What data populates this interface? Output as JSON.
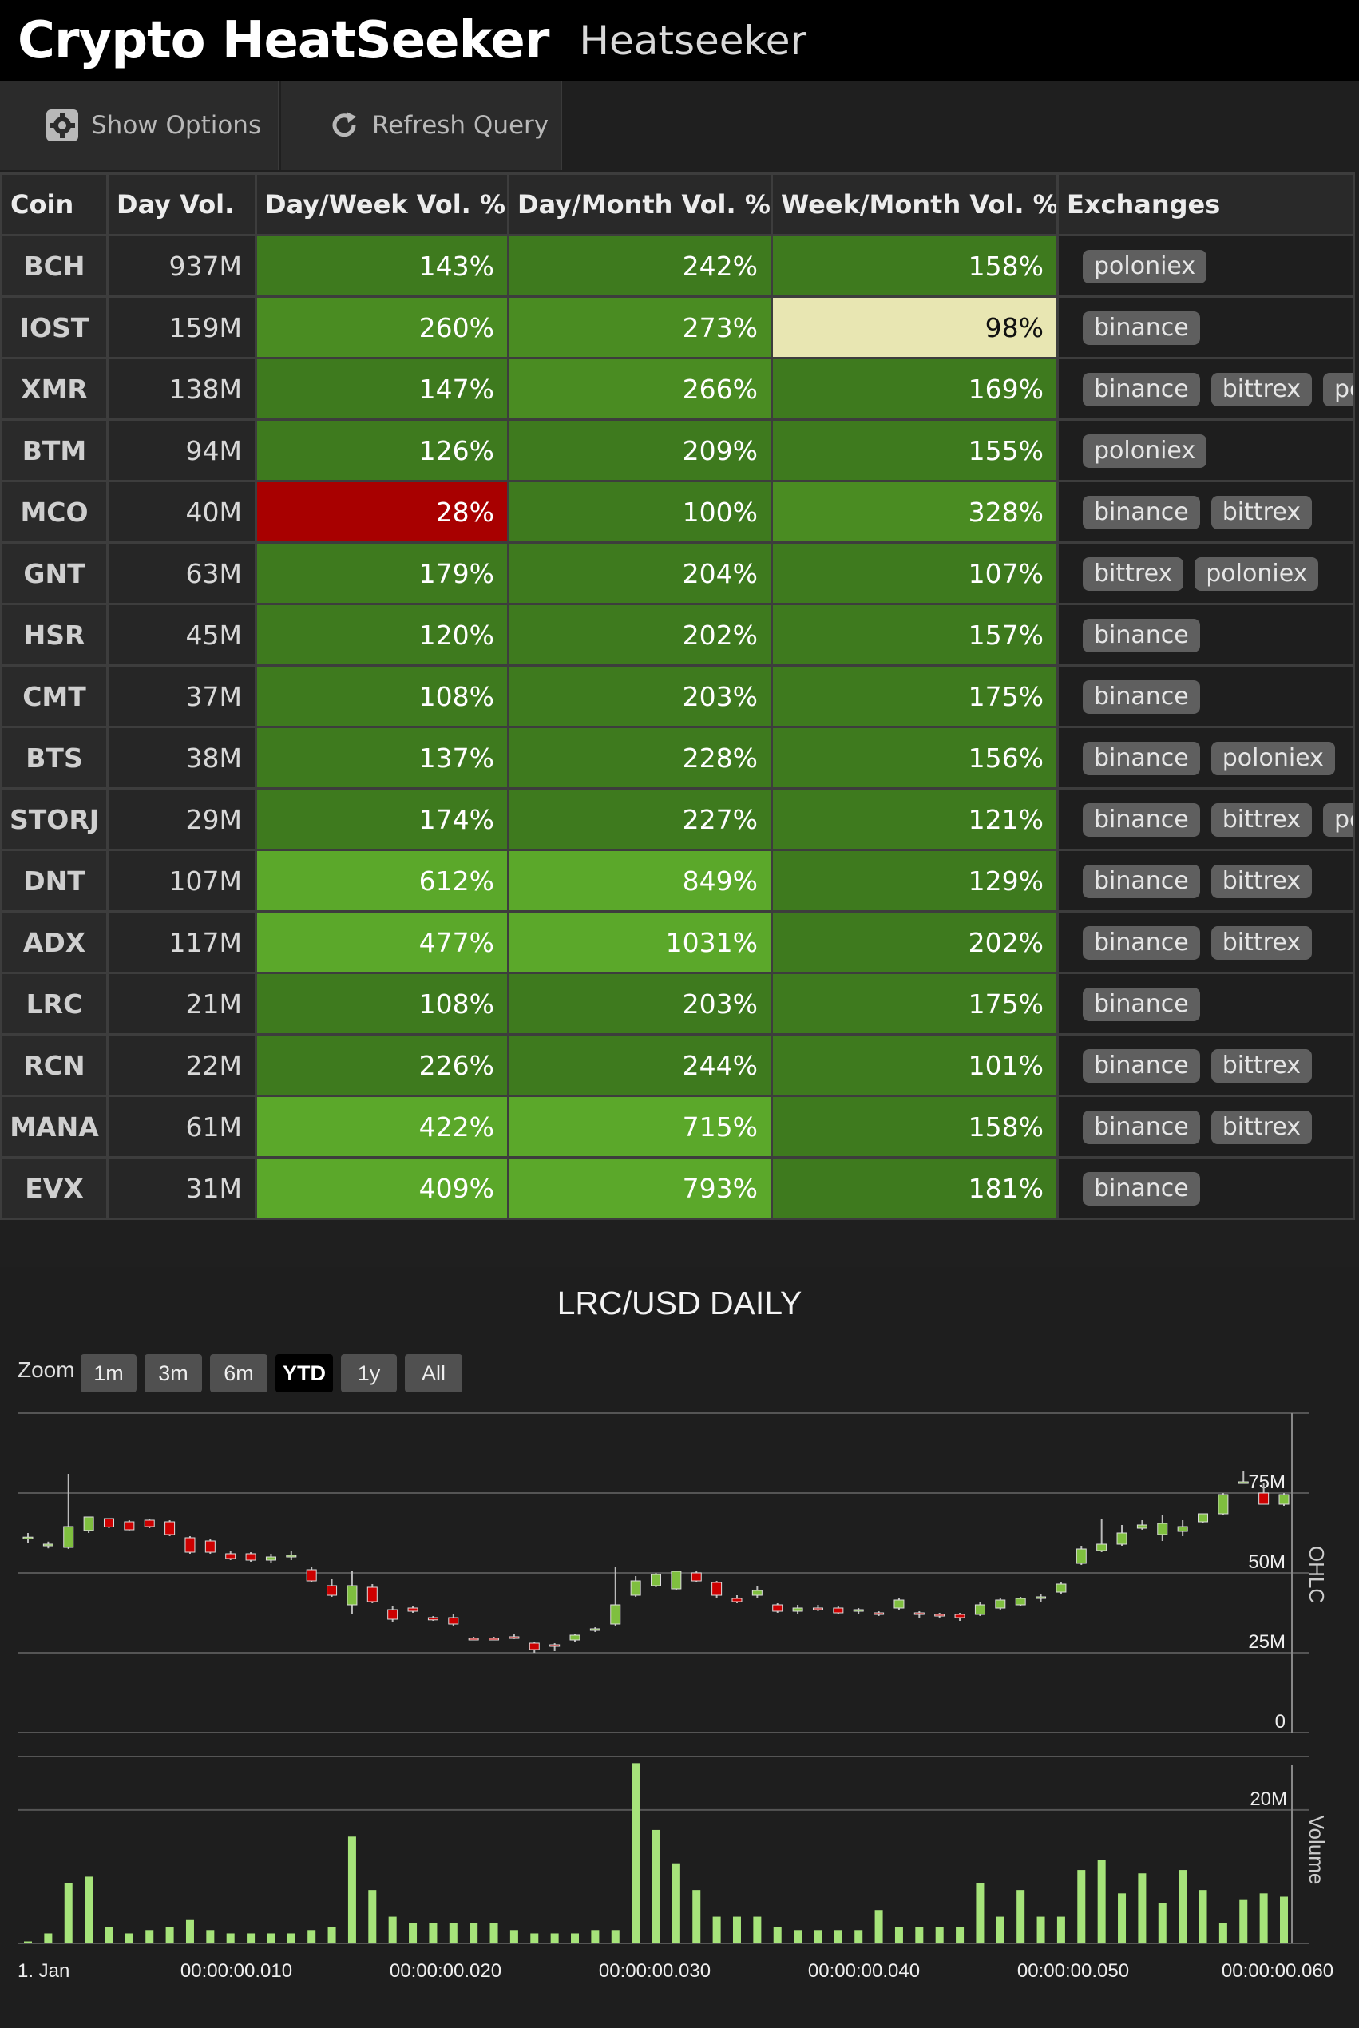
{
  "app": {
    "title": "Crypto HeatSeeker",
    "subtitle": "Heatseeker"
  },
  "toolbar": {
    "show_options": "Show Options",
    "refresh_query": "Refresh Query"
  },
  "table": {
    "headers": [
      "Coin",
      "Day Vol.",
      "Day/Week Vol. %",
      "Day/Month Vol. %",
      "Week/Month Vol. %",
      "Exchanges"
    ],
    "rows": [
      {
        "coin": "BCH",
        "day_vol": "937M",
        "dw": "143%",
        "dm": "242%",
        "wm": "158%",
        "exchanges": [
          "poloniex"
        ]
      },
      {
        "coin": "IOST",
        "day_vol": "159M",
        "dw": "260%",
        "dm": "273%",
        "wm": "98%",
        "exchanges": [
          "binance"
        ]
      },
      {
        "coin": "XMR",
        "day_vol": "138M",
        "dw": "147%",
        "dm": "266%",
        "wm": "169%",
        "exchanges": [
          "binance",
          "bittrex",
          "poloniex"
        ]
      },
      {
        "coin": "BTM",
        "day_vol": "94M",
        "dw": "126%",
        "dm": "209%",
        "wm": "155%",
        "exchanges": [
          "poloniex"
        ]
      },
      {
        "coin": "MCO",
        "day_vol": "40M",
        "dw": "28%",
        "dm": "100%",
        "wm": "328%",
        "exchanges": [
          "binance",
          "bittrex"
        ]
      },
      {
        "coin": "GNT",
        "day_vol": "63M",
        "dw": "179%",
        "dm": "204%",
        "wm": "107%",
        "exchanges": [
          "bittrex",
          "poloniex"
        ]
      },
      {
        "coin": "HSR",
        "day_vol": "45M",
        "dw": "120%",
        "dm": "202%",
        "wm": "157%",
        "exchanges": [
          "binance"
        ]
      },
      {
        "coin": "CMT",
        "day_vol": "37M",
        "dw": "108%",
        "dm": "203%",
        "wm": "175%",
        "exchanges": [
          "binance"
        ]
      },
      {
        "coin": "BTS",
        "day_vol": "38M",
        "dw": "137%",
        "dm": "228%",
        "wm": "156%",
        "exchanges": [
          "binance",
          "poloniex"
        ]
      },
      {
        "coin": "STORJ",
        "day_vol": "29M",
        "dw": "174%",
        "dm": "227%",
        "wm": "121%",
        "exchanges": [
          "binance",
          "bittrex",
          "poloniex"
        ]
      },
      {
        "coin": "DNT",
        "day_vol": "107M",
        "dw": "612%",
        "dm": "849%",
        "wm": "129%",
        "exchanges": [
          "binance",
          "bittrex"
        ]
      },
      {
        "coin": "ADX",
        "day_vol": "117M",
        "dw": "477%",
        "dm": "1031%",
        "wm": "202%",
        "exchanges": [
          "binance",
          "bittrex"
        ]
      },
      {
        "coin": "LRC",
        "day_vol": "21M",
        "dw": "108%",
        "dm": "203%",
        "wm": "175%",
        "exchanges": [
          "binance"
        ]
      },
      {
        "coin": "RCN",
        "day_vol": "22M",
        "dw": "226%",
        "dm": "244%",
        "wm": "101%",
        "exchanges": [
          "binance",
          "bittrex"
        ]
      },
      {
        "coin": "MANA",
        "day_vol": "61M",
        "dw": "422%",
        "dm": "715%",
        "wm": "158%",
        "exchanges": [
          "binance",
          "bittrex"
        ]
      },
      {
        "coin": "EVX",
        "day_vol": "31M",
        "dw": "409%",
        "dm": "793%",
        "wm": "181%",
        "exchanges": [
          "binance"
        ]
      }
    ],
    "heat_colors": {
      "cool": "#e8e6b2",
      "cold": "#a80000",
      "mid": "#3e7a1e",
      "warm": "#4a8c22",
      "hot": "#5ba82a"
    }
  },
  "chart": {
    "zoom_label": "Zoom",
    "zoom_buttons": [
      "1m",
      "3m",
      "6m",
      "YTD",
      "1y",
      "All"
    ],
    "zoom_selected": "YTD"
  },
  "chart_data": {
    "type": "candlestick",
    "title": "LRC/USD DAILY",
    "ohlc_axis_title": "OHLC",
    "volume_axis_title": "Volume",
    "ohlc_ticks": [
      "0",
      "25M",
      "50M",
      "75M"
    ],
    "ohlc_ylim": [
      0,
      100000000
    ],
    "volume_ticks": [
      "20M"
    ],
    "volume_ylim": [
      0,
      28000000
    ],
    "x_tick_labels": [
      "1. Jan",
      "00:00:00.010",
      "00:00:00.020",
      "00:00:00.030",
      "00:00:00.040",
      "00:00:00.050",
      "00:00:00.060"
    ],
    "x_range": [
      0,
      60
    ],
    "up_color": "#7fbf3f",
    "down_color": "#cc0000",
    "volume_color": "#a6e37a",
    "ohlc": [
      [
        61.0,
        62.5,
        59.5,
        61.2
      ],
      [
        58.5,
        59.8,
        57.7,
        59.0
      ],
      [
        58.0,
        81.0,
        57.5,
        64.5
      ],
      [
        63.3,
        67.0,
        62.5,
        67.5
      ],
      [
        67.0,
        67.0,
        64.0,
        64.4
      ],
      [
        66.0,
        66.5,
        63.3,
        63.5
      ],
      [
        66.5,
        67.0,
        64.0,
        64.5
      ],
      [
        66.0,
        66.5,
        61.5,
        62.0
      ],
      [
        61.0,
        61.5,
        56.0,
        56.5
      ],
      [
        60.0,
        60.5,
        56.0,
        56.5
      ],
      [
        56.0,
        57.0,
        54.0,
        54.5
      ],
      [
        56.0,
        56.5,
        53.5,
        54.0
      ],
      [
        54.0,
        56.0,
        53.0,
        55.0
      ],
      [
        55.0,
        57.0,
        54.0,
        55.5
      ],
      [
        51.0,
        52.0,
        47.0,
        47.5
      ],
      [
        46.0,
        48.0,
        42.5,
        43.0
      ],
      [
        40.0,
        50.5,
        37.0,
        46.0
      ],
      [
        45.5,
        46.5,
        40.5,
        41.0
      ],
      [
        38.5,
        39.5,
        34.5,
        35.5
      ],
      [
        39.0,
        39.5,
        37.5,
        38.0
      ],
      [
        36.0,
        36.5,
        35.0,
        35.3
      ],
      [
        36.0,
        37.0,
        33.5,
        34.0
      ],
      [
        29.5,
        30.0,
        29.0,
        29.3
      ],
      [
        29.5,
        30.0,
        29.0,
        29.3
      ],
      [
        30.0,
        31.0,
        29.3,
        29.7
      ],
      [
        28.0,
        28.5,
        25.0,
        26.0
      ],
      [
        27.5,
        28.0,
        25.5,
        27.0
      ],
      [
        29.0,
        31.0,
        28.5,
        30.5
      ],
      [
        32.0,
        33.0,
        31.5,
        32.5
      ],
      [
        34.0,
        52.0,
        33.5,
        40.0
      ],
      [
        43.0,
        49.0,
        42.5,
        47.5
      ],
      [
        46.0,
        50.0,
        45.5,
        49.5
      ],
      [
        45.0,
        50.0,
        44.5,
        50.5
      ],
      [
        50.0,
        50.5,
        47.0,
        47.5
      ],
      [
        47.0,
        47.5,
        42.0,
        43.0
      ],
      [
        42.0,
        43.0,
        40.5,
        41.0
      ],
      [
        43.0,
        46.0,
        42.0,
        44.5
      ],
      [
        40.0,
        40.5,
        37.5,
        38.0
      ],
      [
        38.0,
        40.0,
        37.0,
        39.0
      ],
      [
        39.0,
        40.0,
        38.0,
        38.5
      ],
      [
        39.0,
        39.5,
        37.0,
        37.5
      ],
      [
        38.0,
        39.0,
        37.0,
        38.5
      ],
      [
        37.5,
        38.0,
        36.5,
        37.0
      ],
      [
        39.0,
        42.0,
        38.5,
        41.5
      ],
      [
        37.5,
        38.0,
        36.0,
        37.0
      ],
      [
        37.0,
        37.5,
        36.0,
        36.5
      ],
      [
        37.0,
        37.5,
        35.0,
        36.0
      ],
      [
        37.0,
        41.0,
        36.5,
        40.0
      ],
      [
        39.0,
        42.0,
        38.5,
        41.5
      ],
      [
        40.0,
        42.5,
        39.5,
        42.0
      ],
      [
        42.0,
        43.5,
        41.0,
        42.5
      ],
      [
        44.0,
        47.0,
        43.5,
        46.5
      ],
      [
        53.0,
        58.5,
        52.5,
        57.5
      ],
      [
        57.0,
        67.0,
        56.5,
        59.0
      ],
      [
        59.0,
        65.0,
        58.5,
        62.5
      ],
      [
        64.0,
        66.5,
        63.5,
        65.0
      ],
      [
        62.0,
        68.0,
        60.0,
        65.5
      ],
      [
        63.0,
        66.5,
        61.5,
        64.5
      ],
      [
        66.0,
        68.5,
        65.5,
        68.5
      ],
      [
        68.5,
        75.0,
        68.0,
        74.5
      ],
      [
        78.5,
        82.0,
        78.0,
        78.5
      ],
      [
        75.0,
        78.0,
        73.0,
        71.5
      ],
      [
        71.5,
        75.0,
        71.0,
        74.5
      ]
    ],
    "volume": [
      0.3,
      1.5,
      9.0,
      10.0,
      2.5,
      1.5,
      2.0,
      2.5,
      3.5,
      2.0,
      1.5,
      1.5,
      1.5,
      1.5,
      2.0,
      2.5,
      16.0,
      8.0,
      4.0,
      3.0,
      3.0,
      3.0,
      3.0,
      3.0,
      2.0,
      1.5,
      1.5,
      1.5,
      2.0,
      2.0,
      27.0,
      17.0,
      12.0,
      8.0,
      4.0,
      4.0,
      4.0,
      2.5,
      2.0,
      2.0,
      2.0,
      2.0,
      5.0,
      2.5,
      2.5,
      2.5,
      2.5,
      9.0,
      4.0,
      8.0,
      4.0,
      4.0,
      11.0,
      12.5,
      7.5,
      10.5,
      6.0,
      11.0,
      8.0,
      3.0,
      6.5,
      7.5,
      7.0,
      6.0,
      3.0,
      1.5,
      1.0,
      3.0
    ]
  }
}
